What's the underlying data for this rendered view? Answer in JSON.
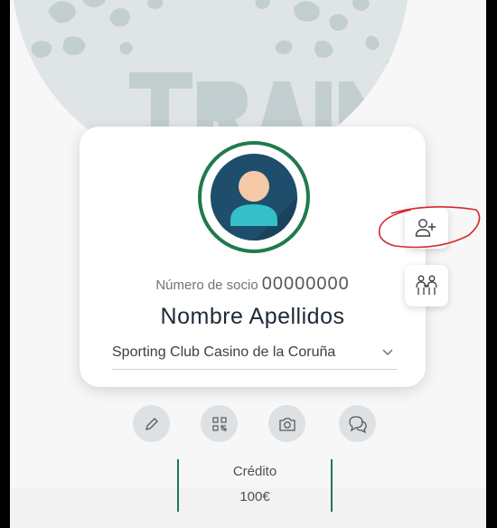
{
  "header": {
    "background_color": "#dfe5e6",
    "pattern_color": "#c3ced0"
  },
  "profile": {
    "member_label": "Número de socio",
    "member_number": "00000000",
    "full_name": "Nombre Apellidos",
    "club_selected": "Sporting Club Casino de la Coruña",
    "accent_color": "#1f7a4d"
  },
  "side_actions": [
    {
      "icon": "add-person-icon"
    },
    {
      "icon": "family-icon"
    }
  ],
  "actions": [
    {
      "icon": "pencil-icon"
    },
    {
      "icon": "qr-code-icon"
    },
    {
      "icon": "camera-icon"
    },
    {
      "icon": "chat-icon"
    }
  ],
  "credit": {
    "label": "Crédito",
    "value": "100€"
  }
}
